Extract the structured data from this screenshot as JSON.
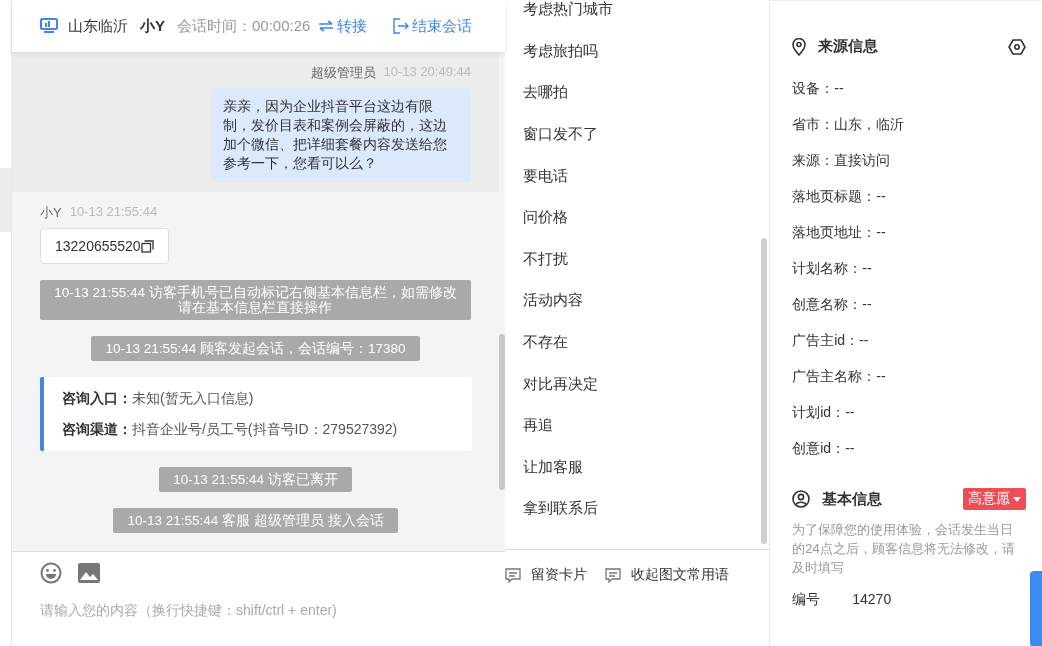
{
  "header": {
    "location": "山东临沂",
    "visitor": "小Y",
    "session_time_label": "会话时间：",
    "session_time": "00:00:26",
    "transfer": "转接",
    "end": "结束会话"
  },
  "messages": [
    {
      "kind": "agent",
      "sender": "超级管理员",
      "time": "10-13 20:49:44",
      "text": "亲亲，因为企业抖音平台这边有限制，发价目表和案例会屏蔽的，这边加个微信、把详细套餐内容发送给您参考一下，您看可以么？"
    },
    {
      "kind": "visitor",
      "sender": "小Y",
      "time": "10-13 21:55:44",
      "text": "13220655520"
    },
    {
      "kind": "system",
      "text": "10-13 21:55:44 访客手机号已自动标记右侧基本信息栏，如需修改请在基本信息栏直接操作"
    },
    {
      "kind": "system",
      "text": "10-13 21:55:44 顾客发起会话，会话编号：17380"
    },
    {
      "kind": "entry",
      "rows": [
        {
          "label": "咨询入口：",
          "value": "未知(暂无入口信息)"
        },
        {
          "label": "咨询渠道：",
          "value": "抖音企业号/员工号(抖音号ID：279527392)"
        }
      ]
    },
    {
      "kind": "system",
      "text": "10-13 21:55:44 访客已离开"
    },
    {
      "kind": "system",
      "text": "10-13 21:55:44 客服 超级管理员 接入会话"
    }
  ],
  "composer": {
    "placeholder": "请输入您的内容（换行快捷键：shift/ctrl + enter)"
  },
  "quick_replies": [
    "考虑热门城市",
    "考虑旅拍吗",
    "去哪拍",
    "窗口发不了",
    "要电话",
    "问价格",
    "不打扰",
    "活动内容",
    "不存在",
    "对比再决定",
    "再追",
    "让加客服",
    "拿到联系后"
  ],
  "quick_tools": [
    "留资卡片",
    "收起图文常用语"
  ],
  "source_info": {
    "title": "来源信息",
    "fields": [
      "设备：--",
      "省市：山东，临沂",
      "来源：直接访问",
      "落地页标题：--",
      "落地页地址：--",
      "计划名称：--",
      "创意名称：--",
      "广告主id：--",
      "广告主名称：--",
      "计划id：--",
      "创意id：--"
    ]
  },
  "basic_info": {
    "title": "基本信息",
    "tag": "高意愿",
    "notice": "为了保障您的使用体验，会话发生当日的24点之后，顾客信息将无法修改，请及时填写",
    "fields": [
      {
        "label": "编号",
        "value": "14270"
      }
    ]
  }
}
